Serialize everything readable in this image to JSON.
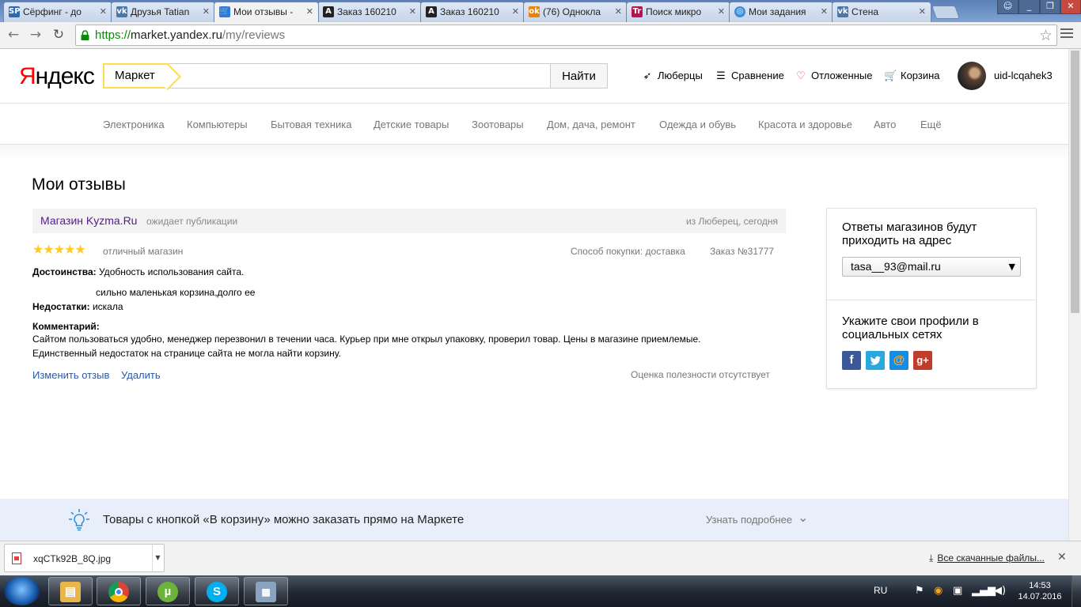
{
  "browser": {
    "tabs": [
      {
        "title": "Сёрфинг - до",
        "icon": "sp",
        "color": "#2d6ab5"
      },
      {
        "title": "Друзья Tatian",
        "icon": "vk",
        "color": "#4a76a8"
      },
      {
        "title": "Мои отзывы -",
        "icon": "cart",
        "color": "#2c7be5"
      },
      {
        "title": "Заказ 160210",
        "icon": "A",
        "color": "#222222"
      },
      {
        "title": "Заказ 160210",
        "icon": "A",
        "color": "#222222"
      },
      {
        "title": "(76) Однокла",
        "icon": "ok",
        "color": "#ee8208"
      },
      {
        "title": "Поиск микро",
        "icon": "tr",
        "color": "#b8124f"
      },
      {
        "title": "Мои задания",
        "icon": "target",
        "color": "#3a8fd8"
      },
      {
        "title": "Стена",
        "icon": "vk",
        "color": "#4a76a8"
      }
    ],
    "url_scheme": "https://",
    "url_host": "market.yandex.ru",
    "url_path": "/my/reviews"
  },
  "header": {
    "logo_first": "Я",
    "logo_rest": "ндекс",
    "search_tag": "Маркет",
    "search_value": "",
    "find_label": "Найти",
    "region": "Люберцы",
    "compare": "Сравнение",
    "deferred": "Отложенные",
    "cart": "Корзина",
    "username": "uid-lcqahek3"
  },
  "categories": [
    "Электроника",
    "Компьютеры",
    "Бытовая техника",
    "Детские товары",
    "Зоотовары",
    "Дом, дача, ремонт",
    "Одежда и обувь",
    "Красота и здоровье",
    "Авто",
    "Ещё"
  ],
  "review": {
    "page_title": "Мои отзывы",
    "shop_name": "Магазин Kyzma.Ru",
    "status": "ожидает публикации",
    "location_date": "из Люберец, сегодня",
    "rating": 5,
    "rating_text": "отличный магазин",
    "purchase_method": "Способ покупки: доставка",
    "order": "Заказ №31777",
    "pros_label": "Достоинства:",
    "pros_text": "Удобность использования сайта.",
    "cons_line1": "сильно маленькая корзина,долго ее",
    "cons_label": "Недостатки:",
    "cons_text": "искала",
    "comment_label": "Комментарий:",
    "comment_line1": "Сайтом пользоваться удобно, менеджер перезвонил в течении часа. Курьер при мне открыл упаковку, проверил товар. Цены в магазине приемлемые.",
    "comment_line2": "Единственный недостаток на странице сайта не могла найти корзину.",
    "edit_link": "Изменить отзыв",
    "delete_link": "Удалить",
    "usefulness": "Оценка полезности отсутствует"
  },
  "sidebar": {
    "replies_title": "Ответы магазинов будут приходить на адрес",
    "email": "tasa__93@mail.ru",
    "social_title": "Укажите свои профили в социальных сетях",
    "social_icons": [
      "facebook-icon",
      "twitter-icon",
      "mailru-icon",
      "google-plus-icon"
    ]
  },
  "banner": {
    "text": "Товары с кнопкой «В корзину» можно заказать прямо на Маркете",
    "more": "Узнать подробнее"
  },
  "downloads": {
    "file_name": "xqCTk92B_8Q.jpg",
    "all_downloads": "Все скачанные файлы..."
  },
  "taskbar": {
    "lang": "RU",
    "time": "14:53",
    "date": "14.07.2016"
  },
  "colors": {
    "accent_yellow": "#ffdb4d",
    "link_blue": "#2a59a8",
    "visited_purple": "#551a8b",
    "star_gold": "#ffc928"
  }
}
